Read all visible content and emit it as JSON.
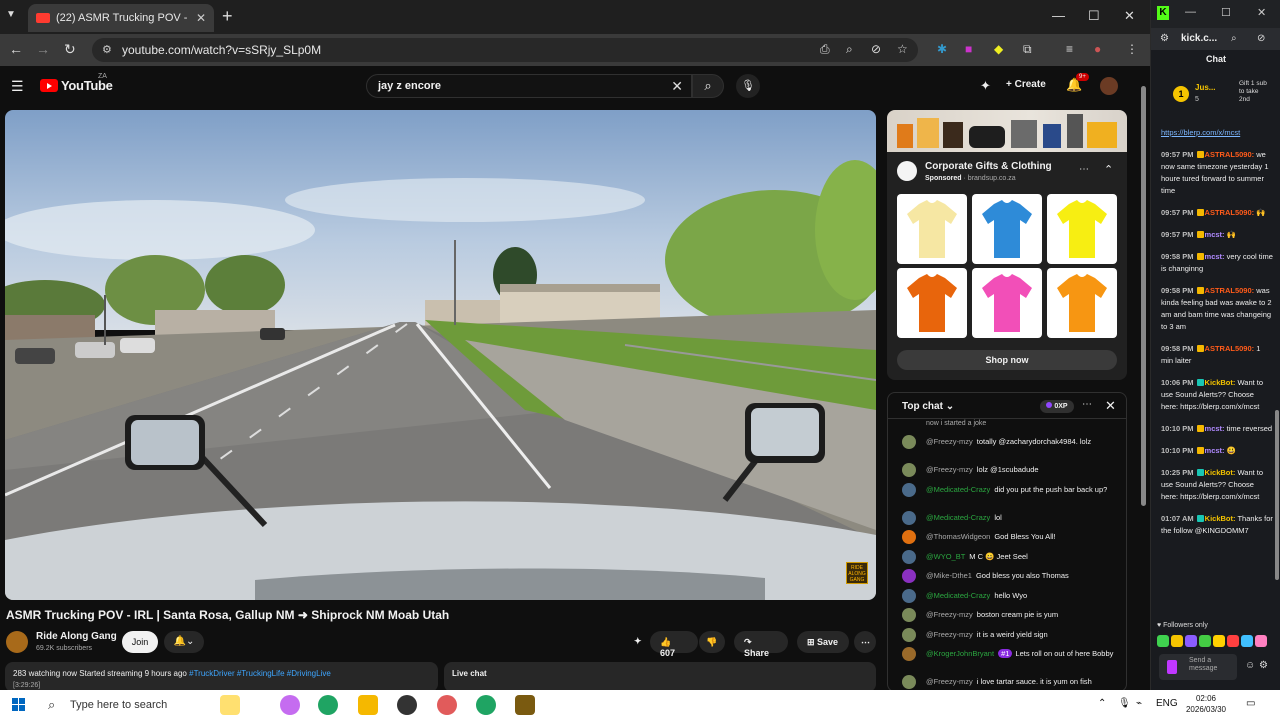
{
  "browser": {
    "tab_title": "(22) ASMR Trucking POV - I",
    "url": "youtube.com/watch?v=sSRjy_SLp0M"
  },
  "youtube": {
    "logo_text": "YouTube",
    "country_code": "ZA",
    "search_value": "jay z encore",
    "create_label": "Create",
    "notif_count": "9+",
    "video_watermark": "RIDE ALONG GANG",
    "video_title": "ASMR Trucking POV - IRL | Santa Rosa, Gallup NM ➜ Shiprock NM Moab Utah",
    "channel_name": "Ride Along Gang",
    "subscribers": "69.2K subscribers",
    "join_label": "Join",
    "like_count": "607",
    "share_label": "Share",
    "save_label": "Save",
    "desc_stats": "283 watching now  Started streaming 9 hours ago",
    "desc_tags": "#TruckDriver #TruckingLife #DrivingLive",
    "desc_timestamp": "[3:29:26]",
    "live_chat_label": "Live chat"
  },
  "ad": {
    "title": "Corporate Gifts & Clothing",
    "sponsored": "Sponsored",
    "domain": "brandsup.co.za",
    "shop_now": "Shop now",
    "shirt_colors": [
      "#f6e7a3",
      "#2e8bd8",
      "#f7ee12",
      "#e8650c",
      "#f24fb8",
      "#f79612"
    ]
  },
  "yt_chat": {
    "header": "Top chat",
    "xp": "0XP",
    "partial_top": "now i started a joke",
    "messages": [
      {
        "author": "@Freezy-mzy",
        "text": "totally @zacharydorchak4984. lolz",
        "color": "#7a8a5a",
        "mod": false
      },
      {
        "author": "@Freezy-mzy",
        "text": "lolz @1scubadude",
        "color": "#7a8a5a",
        "mod": false
      },
      {
        "author": "@Medicated-Crazy",
        "text": "did you put the push bar back up?",
        "color": "#4a6a8a",
        "mod": true
      },
      {
        "author": "@Medicated-Crazy",
        "text": "lol",
        "color": "#4a6a8a",
        "mod": true
      },
      {
        "author": "@ThomasWidgeon",
        "text": "God Bless You All!",
        "color": "#e07010",
        "mod": false
      },
      {
        "author": "@WYO_BT",
        "text": "M C 😀 Jeet Seel",
        "color": "#4a6a8a",
        "mod": true
      },
      {
        "author": "@Mike-Dthe1",
        "text": "God bless you also Thomas",
        "color": "#8a30c0",
        "mod": false
      },
      {
        "author": "@Medicated-Crazy",
        "text": "hello Wyo",
        "color": "#4a6a8a",
        "mod": true
      },
      {
        "author": "@Freezy-mzy",
        "text": "boston cream pie is yum",
        "color": "#7a8a5a",
        "mod": false
      },
      {
        "author": "@Freezy-mzy",
        "text": "it is a weird yield sign",
        "color": "#7a8a5a",
        "mod": false
      },
      {
        "author": "@KrogerJohnBryant",
        "text": "Lets roll on out of here Bobby",
        "color": "#9a6a2a",
        "mod": true,
        "badge": "#1"
      },
      {
        "author": "@Freezy-mzy",
        "text": "i love tartar sauce. it is yum on fish",
        "color": "#7a8a5a",
        "mod": false
      }
    ]
  },
  "kick": {
    "url": "kick.c...",
    "chat_label": "Chat",
    "gift_user": "Jus...",
    "gift_count": "5",
    "gift_text": "Gift 1 sub to take 2nd",
    "followers_only": "Followers only",
    "input_placeholder": "Send a message",
    "messages": [
      {
        "time": "",
        "author": "",
        "text": "https://blerp.com/x/mcst",
        "link": true,
        "color": "#7cb7ff"
      },
      {
        "time": "09:57 PM",
        "author": "ASTRAL5090:",
        "text": "we now same timezone yesterday 1 houre tured forward to summer time",
        "color": "#ff5b1a"
      },
      {
        "time": "09:57 PM",
        "author": "ASTRAL5090:",
        "text": "🙌",
        "color": "#ff5b1a"
      },
      {
        "time": "09:57 PM",
        "author": "mcst:",
        "text": "🙌",
        "color": "#b08aff"
      },
      {
        "time": "09:58 PM",
        "author": "mcst:",
        "text": "very cool time is changinng",
        "color": "#b08aff"
      },
      {
        "time": "09:58 PM",
        "author": "ASTRAL5090:",
        "text": "was kinda feeling bad was awake to 2 am and bam time was changeing to 3 am",
        "color": "#ff5b1a"
      },
      {
        "time": "09:58 PM",
        "author": "ASTRAL5090:",
        "text": "1 min laiter",
        "color": "#ff5b1a"
      },
      {
        "time": "10:06 PM",
        "author": "KickBot:",
        "text": "Want to use Sound Alerts?? Choose here: https://blerp.com/x/mcst",
        "color": "#f2c200"
      },
      {
        "time": "10:10 PM",
        "author": "mcst:",
        "text": "time reversed",
        "color": "#b08aff"
      },
      {
        "time": "10:10 PM",
        "author": "mcst:",
        "text": "😃",
        "color": "#b08aff"
      },
      {
        "time": "10:25 PM",
        "author": "KickBot:",
        "text": "Want to use Sound Alerts?? Choose here: https://blerp.com/x/mcst",
        "color": "#f2c200"
      },
      {
        "time": "01:07 AM",
        "author": "KickBot:",
        "text": "Thanks for the follow @KINGDOMM7",
        "color": "#f2c200"
      }
    ],
    "emote_colors": [
      "#3fd24f",
      "#f5c400",
      "#8a5cff",
      "#44cc44",
      "#ffd000",
      "#ff4040",
      "#40c0ff",
      "#ff80c0"
    ]
  },
  "taskbar": {
    "search_placeholder": "Type here to search",
    "lang": "ENG",
    "time": "02:06",
    "date": "2026/03/30"
  }
}
